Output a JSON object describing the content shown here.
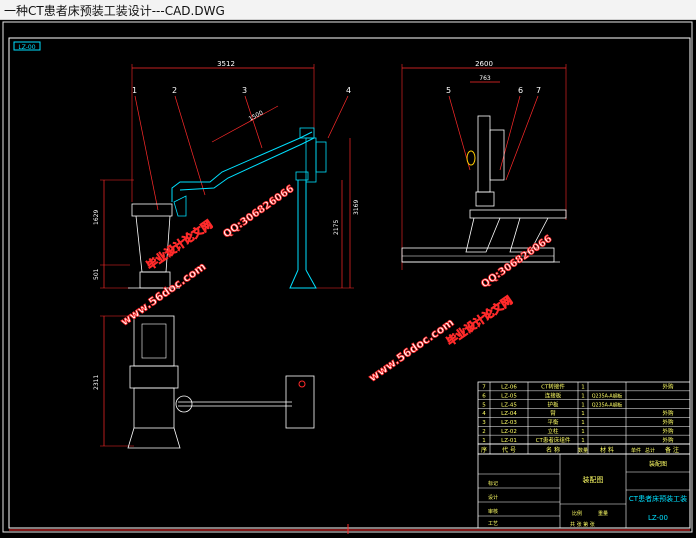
{
  "window": {
    "title": "一种CT患者床预装工装设计---CAD.DWG"
  },
  "drawing": {
    "tag": "LZ-00",
    "front_view": {
      "dim_top": "3512",
      "dim_arm": "1500",
      "dim_left_upper": "1629",
      "dim_left_lower": "501",
      "dim_right_outer": "3169",
      "dim_right_inner": "2175",
      "balloons": [
        "1",
        "2",
        "3",
        "4"
      ]
    },
    "side_view": {
      "dim_top": "2600",
      "dim_mid": "763",
      "balloons": [
        "5",
        "6",
        "7"
      ]
    },
    "top_view": {
      "dim_left": "2311"
    },
    "watermarks": {
      "site": "www.56doc.com",
      "qq": "QQ:306826066",
      "brand": "毕业设计论文网"
    },
    "bom": {
      "rows": [
        {
          "no": "7",
          "code": "LZ-06",
          "name": "CT转接件",
          "qty": "1",
          "material": "",
          "note": "外购"
        },
        {
          "no": "6",
          "code": "LZ-05",
          "name": "连接板",
          "qty": "1",
          "material": "Q235A-A钢板",
          "note": ""
        },
        {
          "no": "5",
          "code": "LZ-45",
          "name": "护板",
          "qty": "1",
          "material": "Q235A-A钢板",
          "note": ""
        },
        {
          "no": "4",
          "code": "LZ-04",
          "name": "臂",
          "qty": "1",
          "material": "",
          "note": "外购"
        },
        {
          "no": "3",
          "code": "LZ-03",
          "name": "平衡",
          "qty": "1",
          "material": "",
          "note": "外购"
        },
        {
          "no": "2",
          "code": "LZ-02",
          "name": "立柱",
          "qty": "1",
          "material": "",
          "note": "外购"
        },
        {
          "no": "1",
          "code": "LZ-01",
          "name": "CT患者床组件",
          "qty": "1",
          "material": "",
          "note": "外购"
        }
      ],
      "header": [
        "序",
        "代 号",
        "名 称",
        "数量",
        "材 料",
        "单件",
        "总计",
        "备 注"
      ]
    },
    "title_block": {
      "left_labels": [
        "标记",
        "设计",
        "审核",
        "工艺"
      ],
      "center_label": "装配图",
      "drawing_name": "CT患者床预装工装",
      "drawing_no": "LZ-00",
      "scale_label": "比例",
      "weight_label": "重量",
      "sheet": "共 张 第 张"
    }
  }
}
